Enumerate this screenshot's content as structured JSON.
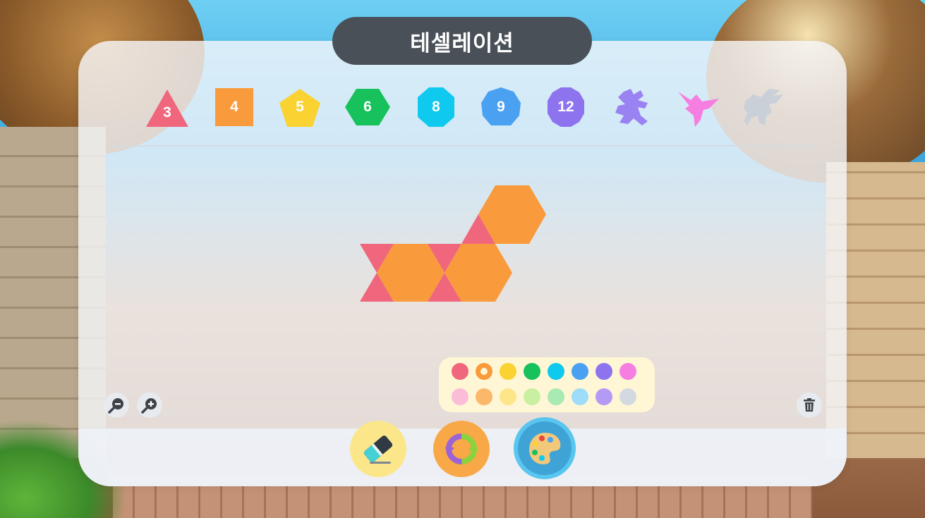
{
  "title": "테셀레이션",
  "shapes": [
    {
      "id": "triangle",
      "label": "3",
      "color": "#f0667c"
    },
    {
      "id": "square",
      "label": "4",
      "color": "#f99b3c"
    },
    {
      "id": "pentagon",
      "label": "5",
      "color": "#fad232"
    },
    {
      "id": "hexagon",
      "label": "6",
      "color": "#17c25c"
    },
    {
      "id": "octagon",
      "label": "8",
      "color": "#0fc9ee"
    },
    {
      "id": "nonagon",
      "label": "9",
      "color": "#4aa1f2"
    },
    {
      "id": "dodecagon",
      "label": "12",
      "color": "#8e73ef"
    },
    {
      "id": "lizard-figure",
      "label": "",
      "color": "#9a82f2"
    },
    {
      "id": "bird-figure",
      "label": "",
      "color": "#f57ee0"
    },
    {
      "id": "pegasus-figure",
      "label": "",
      "color": "#c9d0d8"
    }
  ],
  "canvas_piece_colors": {
    "hexagon": "#f99b3c",
    "triangle": "#f0667c"
  },
  "palette": {
    "row1": [
      "#f0667c",
      "#f99b3c",
      "#fad232",
      "#17c25c",
      "#0fc9ee",
      "#4aa1f2",
      "#8e73ef",
      "#f57ee0"
    ],
    "row2": [
      "#fbbcd8",
      "#fbb86a",
      "#fde58a",
      "#c9f0a0",
      "#a9e9b3",
      "#9edcf9",
      "#b39af5",
      "#d3d9e0"
    ],
    "selected": "#f99b3c"
  },
  "tools": {
    "eraser": {
      "icon": "eraser-icon",
      "bg": "#fbe78a"
    },
    "rotate": {
      "icon": "rotate-icon",
      "bg": "#f9a848"
    },
    "color": {
      "icon": "palette-icon",
      "bg": "#58c6ee",
      "active": true
    }
  },
  "controls": {
    "zoom_out": "zoom-out-icon",
    "zoom_in": "zoom-in-icon",
    "trash": "trash-icon"
  }
}
